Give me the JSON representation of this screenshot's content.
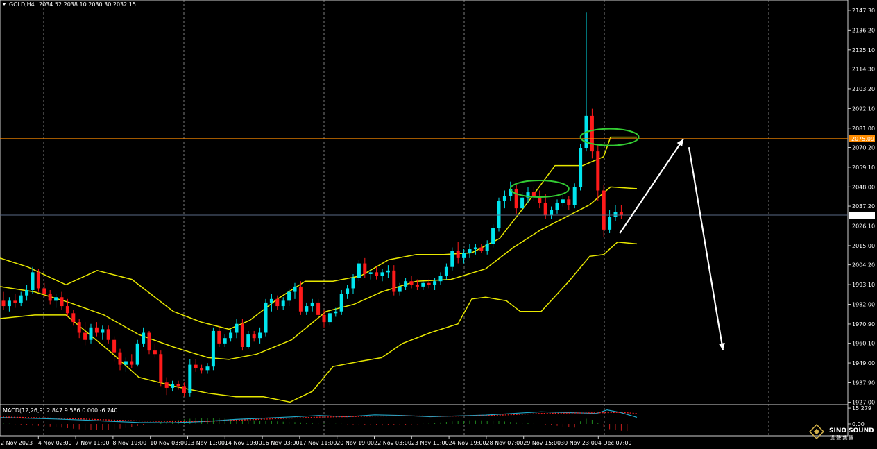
{
  "window": {
    "symbol_label": "GOLD,H4",
    "ohlc_label": "2034.52 2038.10 2030.30 2032.15"
  },
  "macd": {
    "label": "MACD(12,26,9) 2.847 9.586 0.000 -6.740",
    "ticks": [
      "15.279",
      "0.00"
    ]
  },
  "logo": {
    "name": "SINO SOUND",
    "sub": "漢 聲 集 團"
  },
  "colors": {
    "background": "#000000",
    "bull": "#00e5ee",
    "bear": "#ff1a1a",
    "bollinger": "#e8e800",
    "resistance": "#ff8c00",
    "current_price_line": "#5a6a86",
    "circle": "#33cc33",
    "macd_line": "#1fa8c8",
    "macd_signal": "#ff2020",
    "arrow": "#ffffff"
  },
  "chart_data": {
    "type": "candlestick",
    "timeframe": "H4",
    "ylim": [
      1926,
      2150
    ],
    "price_axis_ticks": [
      "2147.30",
      "2136.20",
      "2125.10",
      "2114.30",
      "2103.20",
      "2092.10",
      "2081.00",
      "2070.20",
      "2059.10",
      "2048.00",
      "2037.20",
      "2026.10",
      "2015.00",
      "2004.20",
      "1993.10",
      "1982.00",
      "1970.90",
      "1960.10",
      "1949.00",
      "1937.90",
      "1927.00"
    ],
    "resistance_level": "2075.09",
    "current_price": "2032.15",
    "time_labels": [
      "2 Nov 2023",
      "4 Nov 02:00",
      "7 Nov 11:00",
      "8 Nov 19:00",
      "10 Nov 03:00",
      "13 Nov 11:00",
      "14 Nov 19:00",
      "16 Nov 03:00",
      "17 Nov 11:00",
      "20 Nov 19:00",
      "22 Nov 03:00",
      "23 Nov 11:00",
      "24 Nov 19:00",
      "28 Nov 07:00",
      "29 Nov 15:00",
      "30 Nov 23:00",
      "4 Dec 07:00"
    ],
    "candles": [
      {
        "o": 1984,
        "h": 1989,
        "l": 1979,
        "c": 1981
      },
      {
        "o": 1981,
        "h": 1986,
        "l": 1978,
        "c": 1984
      },
      {
        "o": 1984,
        "h": 1988,
        "l": 1980,
        "c": 1983
      },
      {
        "o": 1983,
        "h": 1989,
        "l": 1981,
        "c": 1987
      },
      {
        "o": 1987,
        "h": 1993,
        "l": 1984,
        "c": 1990
      },
      {
        "o": 1990,
        "h": 2003,
        "l": 1988,
        "c": 2000
      },
      {
        "o": 2000,
        "h": 2002,
        "l": 1989,
        "c": 1991
      },
      {
        "o": 1991,
        "h": 1994,
        "l": 1986,
        "c": 1988
      },
      {
        "o": 1988,
        "h": 1990,
        "l": 1982,
        "c": 1984
      },
      {
        "o": 1984,
        "h": 1988,
        "l": 1980,
        "c": 1986
      },
      {
        "o": 1986,
        "h": 1989,
        "l": 1979,
        "c": 1981
      },
      {
        "o": 1981,
        "h": 1985,
        "l": 1975,
        "c": 1977
      },
      {
        "o": 1977,
        "h": 1979,
        "l": 1970,
        "c": 1972
      },
      {
        "o": 1972,
        "h": 1974,
        "l": 1963,
        "c": 1966
      },
      {
        "o": 1966,
        "h": 1972,
        "l": 1959,
        "c": 1962
      },
      {
        "o": 1962,
        "h": 1971,
        "l": 1960,
        "c": 1969
      },
      {
        "o": 1969,
        "h": 1972,
        "l": 1964,
        "c": 1966
      },
      {
        "o": 1966,
        "h": 1970,
        "l": 1962,
        "c": 1968
      },
      {
        "o": 1968,
        "h": 1970,
        "l": 1960,
        "c": 1962
      },
      {
        "o": 1962,
        "h": 1964,
        "l": 1950,
        "c": 1955
      },
      {
        "o": 1955,
        "h": 1957,
        "l": 1945,
        "c": 1948
      },
      {
        "o": 1948,
        "h": 1952,
        "l": 1944,
        "c": 1950
      },
      {
        "o": 1950,
        "h": 1954,
        "l": 1946,
        "c": 1948
      },
      {
        "o": 1948,
        "h": 1962,
        "l": 1947,
        "c": 1960
      },
      {
        "o": 1960,
        "h": 1969,
        "l": 1958,
        "c": 1966
      },
      {
        "o": 1966,
        "h": 1967,
        "l": 1954,
        "c": 1956
      },
      {
        "o": 1956,
        "h": 1960,
        "l": 1952,
        "c": 1954
      },
      {
        "o": 1954,
        "h": 1956,
        "l": 1936,
        "c": 1938
      },
      {
        "o": 1938,
        "h": 1941,
        "l": 1931,
        "c": 1935
      },
      {
        "o": 1935,
        "h": 1939,
        "l": 1933,
        "c": 1937
      },
      {
        "o": 1937,
        "h": 1939,
        "l": 1934,
        "c": 1936
      },
      {
        "o": 1936,
        "h": 1938,
        "l": 1930,
        "c": 1932
      },
      {
        "o": 1932,
        "h": 1951,
        "l": 1930,
        "c": 1948
      },
      {
        "o": 1948,
        "h": 1951,
        "l": 1944,
        "c": 1946
      },
      {
        "o": 1946,
        "h": 1948,
        "l": 1943,
        "c": 1945
      },
      {
        "o": 1945,
        "h": 1949,
        "l": 1943,
        "c": 1947
      },
      {
        "o": 1947,
        "h": 1969,
        "l": 1945,
        "c": 1967
      },
      {
        "o": 1967,
        "h": 1970,
        "l": 1958,
        "c": 1960
      },
      {
        "o": 1960,
        "h": 1965,
        "l": 1958,
        "c": 1963
      },
      {
        "o": 1963,
        "h": 1968,
        "l": 1961,
        "c": 1966
      },
      {
        "o": 1966,
        "h": 1974,
        "l": 1963,
        "c": 1971
      },
      {
        "o": 1971,
        "h": 1974,
        "l": 1956,
        "c": 1958
      },
      {
        "o": 1958,
        "h": 1967,
        "l": 1957,
        "c": 1965
      },
      {
        "o": 1965,
        "h": 1967,
        "l": 1961,
        "c": 1963
      },
      {
        "o": 1963,
        "h": 1969,
        "l": 1960,
        "c": 1966
      },
      {
        "o": 1966,
        "h": 1985,
        "l": 1964,
        "c": 1983
      },
      {
        "o": 1983,
        "h": 1988,
        "l": 1978,
        "c": 1985
      },
      {
        "o": 1985,
        "h": 1987,
        "l": 1979,
        "c": 1981
      },
      {
        "o": 1981,
        "h": 1986,
        "l": 1979,
        "c": 1984
      },
      {
        "o": 1984,
        "h": 1991,
        "l": 1981,
        "c": 1989
      },
      {
        "o": 1989,
        "h": 1994,
        "l": 1985,
        "c": 1992
      },
      {
        "o": 1992,
        "h": 1995,
        "l": 1976,
        "c": 1978
      },
      {
        "o": 1978,
        "h": 1983,
        "l": 1976,
        "c": 1981
      },
      {
        "o": 1981,
        "h": 1985,
        "l": 1978,
        "c": 1983
      },
      {
        "o": 1983,
        "h": 1985,
        "l": 1974,
        "c": 1976
      },
      {
        "o": 1976,
        "h": 1979,
        "l": 1969,
        "c": 1972
      },
      {
        "o": 1972,
        "h": 1979,
        "l": 1970,
        "c": 1977
      },
      {
        "o": 1977,
        "h": 1980,
        "l": 1975,
        "c": 1978
      },
      {
        "o": 1978,
        "h": 1990,
        "l": 1976,
        "c": 1988
      },
      {
        "o": 1988,
        "h": 1993,
        "l": 1985,
        "c": 1991
      },
      {
        "o": 1991,
        "h": 1999,
        "l": 1988,
        "c": 1997
      },
      {
        "o": 1997,
        "h": 2007,
        "l": 1995,
        "c": 2005
      },
      {
        "o": 2005,
        "h": 2008,
        "l": 1997,
        "c": 1999
      },
      {
        "o": 1999,
        "h": 2002,
        "l": 1996,
        "c": 2000
      },
      {
        "o": 2000,
        "h": 2003,
        "l": 1996,
        "c": 1998
      },
      {
        "o": 1998,
        "h": 2002,
        "l": 1995,
        "c": 2000
      },
      {
        "o": 2000,
        "h": 2004,
        "l": 1997,
        "c": 2001
      },
      {
        "o": 2001,
        "h": 2004,
        "l": 1987,
        "c": 1989
      },
      {
        "o": 1989,
        "h": 1994,
        "l": 1987,
        "c": 1992
      },
      {
        "o": 1992,
        "h": 1997,
        "l": 1990,
        "c": 1995
      },
      {
        "o": 1995,
        "h": 1998,
        "l": 1991,
        "c": 1993
      },
      {
        "o": 1993,
        "h": 1996,
        "l": 1990,
        "c": 1992
      },
      {
        "o": 1992,
        "h": 1995,
        "l": 1990,
        "c": 1994
      },
      {
        "o": 1994,
        "h": 1996,
        "l": 1991,
        "c": 1993
      },
      {
        "o": 1993,
        "h": 1997,
        "l": 1990,
        "c": 1995
      },
      {
        "o": 1995,
        "h": 2000,
        "l": 1993,
        "c": 1998
      },
      {
        "o": 1998,
        "h": 2005,
        "l": 1996,
        "c": 2003
      },
      {
        "o": 2003,
        "h": 2014,
        "l": 2001,
        "c": 2012
      },
      {
        "o": 2012,
        "h": 2017,
        "l": 2005,
        "c": 2008
      },
      {
        "o": 2008,
        "h": 2013,
        "l": 2005,
        "c": 2011
      },
      {
        "o": 2011,
        "h": 2016,
        "l": 2008,
        "c": 2013
      },
      {
        "o": 2013,
        "h": 2016,
        "l": 2010,
        "c": 2014
      },
      {
        "o": 2014,
        "h": 2016,
        "l": 2011,
        "c": 2012
      },
      {
        "o": 2012,
        "h": 2018,
        "l": 2010,
        "c": 2016
      },
      {
        "o": 2016,
        "h": 2027,
        "l": 2014,
        "c": 2025
      },
      {
        "o": 2025,
        "h": 2042,
        "l": 2023,
        "c": 2040
      },
      {
        "o": 2040,
        "h": 2046,
        "l": 2036,
        "c": 2043
      },
      {
        "o": 2043,
        "h": 2051,
        "l": 2040,
        "c": 2047
      },
      {
        "o": 2047,
        "h": 2049,
        "l": 2033,
        "c": 2036
      },
      {
        "o": 2036,
        "h": 2045,
        "l": 2034,
        "c": 2042
      },
      {
        "o": 2042,
        "h": 2048,
        "l": 2039,
        "c": 2045
      },
      {
        "o": 2045,
        "h": 2048,
        "l": 2040,
        "c": 2043
      },
      {
        "o": 2043,
        "h": 2046,
        "l": 2036,
        "c": 2039
      },
      {
        "o": 2039,
        "h": 2044,
        "l": 2030,
        "c": 2032
      },
      {
        "o": 2032,
        "h": 2037,
        "l": 2030,
        "c": 2035
      },
      {
        "o": 2035,
        "h": 2041,
        "l": 2033,
        "c": 2039
      },
      {
        "o": 2039,
        "h": 2044,
        "l": 2037,
        "c": 2041
      },
      {
        "o": 2041,
        "h": 2043,
        "l": 2035,
        "c": 2038
      },
      {
        "o": 2038,
        "h": 2050,
        "l": 2036,
        "c": 2048
      },
      {
        "o": 2048,
        "h": 2072,
        "l": 2046,
        "c": 2070
      },
      {
        "o": 2070,
        "h": 2146,
        "l": 2068,
        "c": 2088
      },
      {
        "o": 2088,
        "h": 2092,
        "l": 2064,
        "c": 2068
      },
      {
        "o": 2068,
        "h": 2072,
        "l": 2040,
        "c": 2046
      },
      {
        "o": 2046,
        "h": 2049,
        "l": 2020,
        "c": 2024
      },
      {
        "o": 2024,
        "h": 2035,
        "l": 2022,
        "c": 2031
      },
      {
        "o": 2031,
        "h": 2038,
        "l": 2029,
        "c": 2034
      },
      {
        "o": 2034,
        "h": 2038,
        "l": 2030,
        "c": 2032
      }
    ],
    "bollinger_upper": [
      [
        0,
        2008
      ],
      [
        40,
        2003
      ],
      [
        95,
        1993
      ],
      [
        140,
        2001
      ],
      [
        190,
        1996
      ],
      [
        250,
        1978
      ],
      [
        290,
        1972
      ],
      [
        330,
        1968
      ],
      [
        360,
        1973
      ],
      [
        400,
        1985
      ],
      [
        440,
        1995
      ],
      [
        480,
        1995
      ],
      [
        520,
        1998
      ],
      [
        560,
        2007
      ],
      [
        600,
        2010
      ],
      [
        640,
        2010
      ],
      [
        680,
        2011
      ],
      [
        720,
        2019
      ],
      [
        760,
        2039
      ],
      [
        800,
        2060
      ],
      [
        840,
        2060
      ],
      [
        870,
        2065
      ],
      [
        880,
        2076
      ],
      [
        918,
        2076
      ]
    ],
    "bollinger_middle": [
      [
        0,
        1992
      ],
      [
        50,
        1989
      ],
      [
        100,
        1983
      ],
      [
        150,
        1976
      ],
      [
        200,
        1965
      ],
      [
        250,
        1958
      ],
      [
        300,
        1952
      ],
      [
        330,
        1951
      ],
      [
        370,
        1954
      ],
      [
        420,
        1962
      ],
      [
        470,
        1978
      ],
      [
        510,
        1982
      ],
      [
        550,
        1989
      ],
      [
        600,
        1995
      ],
      [
        650,
        1996
      ],
      [
        700,
        2002
      ],
      [
        740,
        2014
      ],
      [
        780,
        2024
      ],
      [
        820,
        2032
      ],
      [
        850,
        2038
      ],
      [
        880,
        2048
      ],
      [
        918,
        2047
      ]
    ],
    "bollinger_lower": [
      [
        0,
        1974
      ],
      [
        50,
        1976
      ],
      [
        95,
        1976
      ],
      [
        120,
        1968
      ],
      [
        160,
        1955
      ],
      [
        200,
        1941
      ],
      [
        250,
        1936
      ],
      [
        300,
        1932
      ],
      [
        340,
        1930
      ],
      [
        380,
        1930
      ],
      [
        418,
        1927
      ],
      [
        450,
        1933
      ],
      [
        480,
        1947
      ],
      [
        520,
        1950
      ],
      [
        550,
        1952
      ],
      [
        580,
        1960
      ],
      [
        620,
        1966
      ],
      [
        660,
        1971
      ],
      [
        680,
        1985
      ],
      [
        700,
        1986
      ],
      [
        730,
        1984
      ],
      [
        750,
        1978
      ],
      [
        780,
        1978
      ],
      [
        820,
        1995
      ],
      [
        850,
        2009
      ],
      [
        870,
        2010
      ],
      [
        890,
        2017
      ],
      [
        918,
        2016
      ]
    ],
    "macd_histogram": [
      0.5,
      0.2,
      -0.3,
      -0.8,
      -1.2,
      -1.5,
      -1.8,
      -2.0,
      -2.5,
      -3.0,
      -3.5,
      -4.0,
      -4.5,
      -5.0,
      -5.5,
      -5.8,
      -6.0,
      -6.0,
      -5.5,
      -5.0,
      -4.5,
      -3.8,
      -3.0,
      -2.0,
      -1.0,
      0.0,
      1.0,
      2.0,
      3.0,
      3.5,
      4.0,
      4.5,
      5.0,
      5.5,
      5.8,
      6.0,
      5.8,
      5.5,
      5.0,
      4.6,
      4.2,
      4.0,
      3.8,
      3.5,
      3.2,
      3.0,
      2.8,
      2.5,
      2.2,
      2.0,
      1.8,
      1.5,
      1.2,
      1.0,
      0.8,
      0.6,
      0.4,
      0.2,
      0.1,
      -0.2,
      -0.5,
      -0.8,
      -1.0,
      -1.2,
      -1.3,
      -1.4,
      -1.3,
      -1.2,
      -1.0,
      -0.8,
      -0.5,
      -0.2,
      0.2,
      0.6,
      1.0,
      1.5,
      2.0,
      2.5,
      3.0,
      3.3,
      3.5,
      3.6,
      3.5,
      3.3,
      3.0,
      2.7,
      2.4,
      2.0,
      1.6,
      1.2,
      0.8,
      0.4,
      0.0,
      -0.5,
      -1.0,
      -1.8,
      -2.5,
      -3.0,
      -3.5,
      2.5,
      5.0,
      4.0,
      1.0,
      -3.0,
      -5.0,
      -6.0,
      -6.5,
      -6.7
    ],
    "macd_line": [
      [
        0,
        6.2
      ],
      [
        40,
        5.6
      ],
      [
        80,
        4.8
      ],
      [
        120,
        3.8
      ],
      [
        160,
        2.6
      ],
      [
        200,
        1.5
      ],
      [
        250,
        1.2
      ],
      [
        300,
        2.6
      ],
      [
        340,
        4.4
      ],
      [
        380,
        5.6
      ],
      [
        420,
        6.8
      ],
      [
        460,
        8.2
      ],
      [
        500,
        7.0
      ],
      [
        540,
        8.8
      ],
      [
        580,
        8.2
      ],
      [
        620,
        7.0
      ],
      [
        660,
        7.8
      ],
      [
        700,
        8.6
      ],
      [
        740,
        10.2
      ],
      [
        780,
        11.8
      ],
      [
        820,
        11.0
      ],
      [
        860,
        10.2
      ],
      [
        875,
        13.6
      ],
      [
        895,
        11.0
      ],
      [
        918,
        6.4
      ]
    ],
    "macd_signal": [
      [
        0,
        6.8
      ],
      [
        40,
        6.2
      ],
      [
        80,
        5.6
      ],
      [
        120,
        4.8
      ],
      [
        160,
        3.8
      ],
      [
        200,
        3.0
      ],
      [
        250,
        2.4
      ],
      [
        300,
        2.6
      ],
      [
        340,
        3.6
      ],
      [
        380,
        4.6
      ],
      [
        420,
        5.6
      ],
      [
        460,
        6.6
      ],
      [
        500,
        7.0
      ],
      [
        540,
        7.6
      ],
      [
        580,
        7.8
      ],
      [
        620,
        7.6
      ],
      [
        660,
        7.6
      ],
      [
        700,
        8.0
      ],
      [
        740,
        9.0
      ],
      [
        780,
        10.2
      ],
      [
        820,
        10.6
      ],
      [
        860,
        10.8
      ],
      [
        895,
        11.2
      ],
      [
        918,
        10.2
      ]
    ],
    "annotations": {
      "circles": [
        {
          "center_x": 92,
          "center_y": 2047
        },
        {
          "center_x": 104,
          "center_y": 2076
        }
      ],
      "forecast_arrow": [
        [
          2022
        ],
        [
          2075
        ],
        [
          1964
        ]
      ]
    }
  }
}
